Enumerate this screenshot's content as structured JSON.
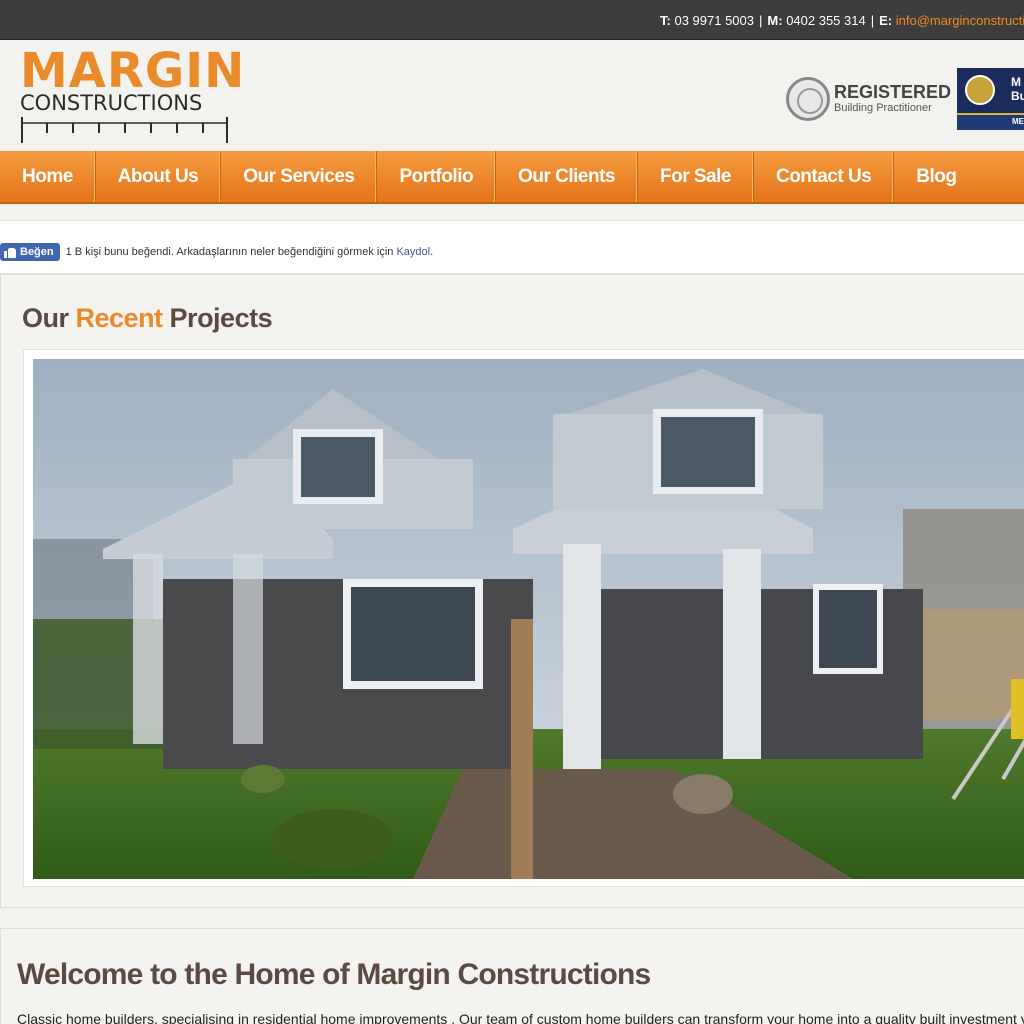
{
  "topbar": {
    "phone_label": "T:",
    "phone": "03 9971 5003",
    "mobile_label": "M:",
    "mobile": "0402 355 314",
    "email_label": "E:",
    "email": "info@marginconstructions"
  },
  "logo": {
    "line1": "MARGIN",
    "line2": "CONSTRUCTIONS"
  },
  "badges": {
    "registered_title": "REGISTERED",
    "registered_sub": "Building Practitioner",
    "mba_text_1": "M",
    "mba_text_2": "Bu",
    "mba_bar": "ME"
  },
  "nav": {
    "items": [
      {
        "label": "Home"
      },
      {
        "label": "About Us"
      },
      {
        "label": "Our Services"
      },
      {
        "label": "Portfolio"
      },
      {
        "label": "Our Clients"
      },
      {
        "label": "For Sale"
      },
      {
        "label": "Contact Us"
      },
      {
        "label": "Blog"
      }
    ]
  },
  "facebook": {
    "button": "Beğen",
    "text": "1 B kişi bunu beğendi. Arkadaşlarının neler beğendiğini görmek için",
    "link": "Kaydol",
    "after": "."
  },
  "projects": {
    "title_a": "Our ",
    "title_highlight": "Recent",
    "title_b": " Projects"
  },
  "welcome": {
    "title": "Welcome to the Home of Margin Constructions",
    "text": "Classic home builders, specialising in residential home improvements . Our team of custom home builders can transform your home into a quality built investment you"
  },
  "colors": {
    "accent": "#ea8a2d",
    "topbar": "#3d3d3d",
    "heading": "#5a4a42",
    "facebook": "#4267b2"
  }
}
